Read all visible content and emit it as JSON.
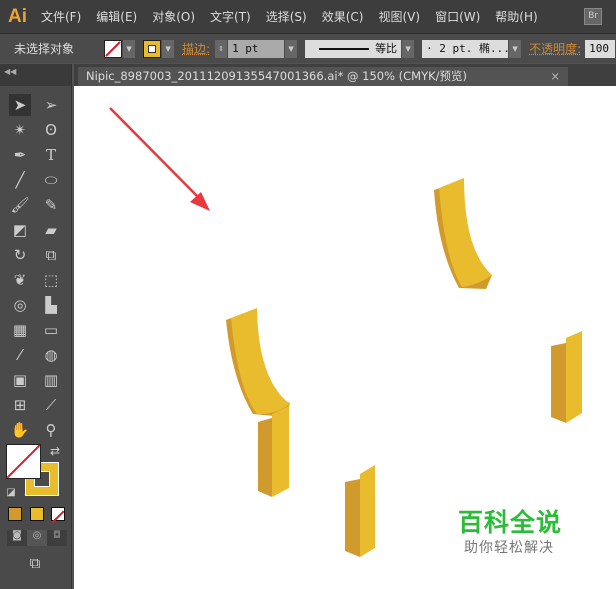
{
  "app": {
    "logo": "Ai",
    "bridge": "Br"
  },
  "menu": [
    "文件(F)",
    "编辑(E)",
    "对象(O)",
    "文字(T)",
    "选择(S)",
    "效果(C)",
    "视图(V)",
    "窗口(W)",
    "帮助(H)"
  ],
  "control": {
    "selection": "未选择对象",
    "stroke_label": "描边:",
    "stroke_value": "1 pt",
    "profile": "等比",
    "brush": "· 2 pt. 椭...",
    "opacity_label": "不透明度:",
    "opacity_value": "100"
  },
  "document": {
    "tab_title": "Nipic_8987003_20111209135547001366.ai* @ 150% (CMYK/预览)",
    "close": "×"
  },
  "watermark": {
    "title": "百科全说",
    "subtitle": "助你轻松解决"
  },
  "colors": {
    "yellow": "#e8bc2c",
    "gold": "#d19a2c",
    "arrow": "#e8383d",
    "watermark": "#2dbb3a"
  }
}
